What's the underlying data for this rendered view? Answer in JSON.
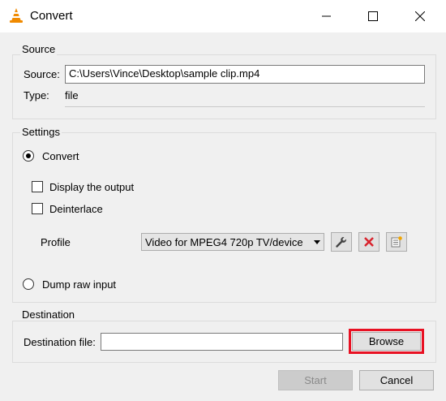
{
  "window": {
    "title": "Convert"
  },
  "source": {
    "group_label": "Source",
    "source_label": "Source:",
    "source_value": "C:\\Users\\Vince\\Desktop\\sample clip.mp4",
    "type_label": "Type:",
    "type_value": "file"
  },
  "settings": {
    "group_label": "Settings",
    "convert_label": "Convert",
    "display_output_label": "Display the output",
    "deinterlace_label": "Deinterlace",
    "profile_label": "Profile",
    "profile_value": "Video for MPEG4 720p TV/device",
    "dump_raw_label": "Dump raw input"
  },
  "destination": {
    "group_label": "Destination",
    "file_label": "Destination file:",
    "file_value": "",
    "browse_label": "Browse"
  },
  "footer": {
    "start_label": "Start",
    "cancel_label": "Cancel"
  },
  "colors": {
    "highlight": "#e81123",
    "delete_red": "#d9232d",
    "cone_orange": "#f08a00"
  }
}
